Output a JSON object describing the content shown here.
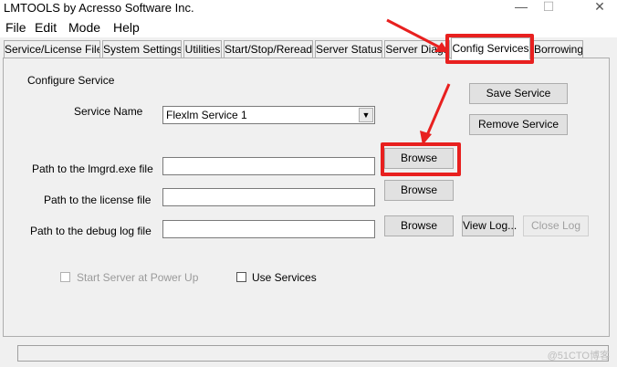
{
  "window": {
    "title": "LMTOOLS by Acresso Software Inc.",
    "minimize": "—",
    "maximize": "☐",
    "close": "✕"
  },
  "menu": [
    "File",
    "Edit",
    "Mode",
    "Help"
  ],
  "tabs": [
    "Service/License File",
    "System Settings",
    "Utilities",
    "Start/Stop/Reread",
    "Server Status",
    "Server Diags",
    "Config Services",
    "Borrowing"
  ],
  "active_tab": "Config Services",
  "panel": {
    "heading": "Configure Service",
    "service_name_label": "Service Name",
    "service_name_value": "Flexlm Service 1",
    "lmgrd_label": "Path to the lmgrd.exe file",
    "license_label": "Path to the license file",
    "debug_label": "Path to the debug log file",
    "browse": "Browse",
    "save_service": "Save Service",
    "remove_service": "Remove Service",
    "view_log": "View Log...",
    "close_log": "Close Log",
    "start_at_power_up": "Start Server at Power Up",
    "use_services": "Use Services"
  },
  "watermark": "@51CTO博客",
  "annotation_color": "#e8201f"
}
